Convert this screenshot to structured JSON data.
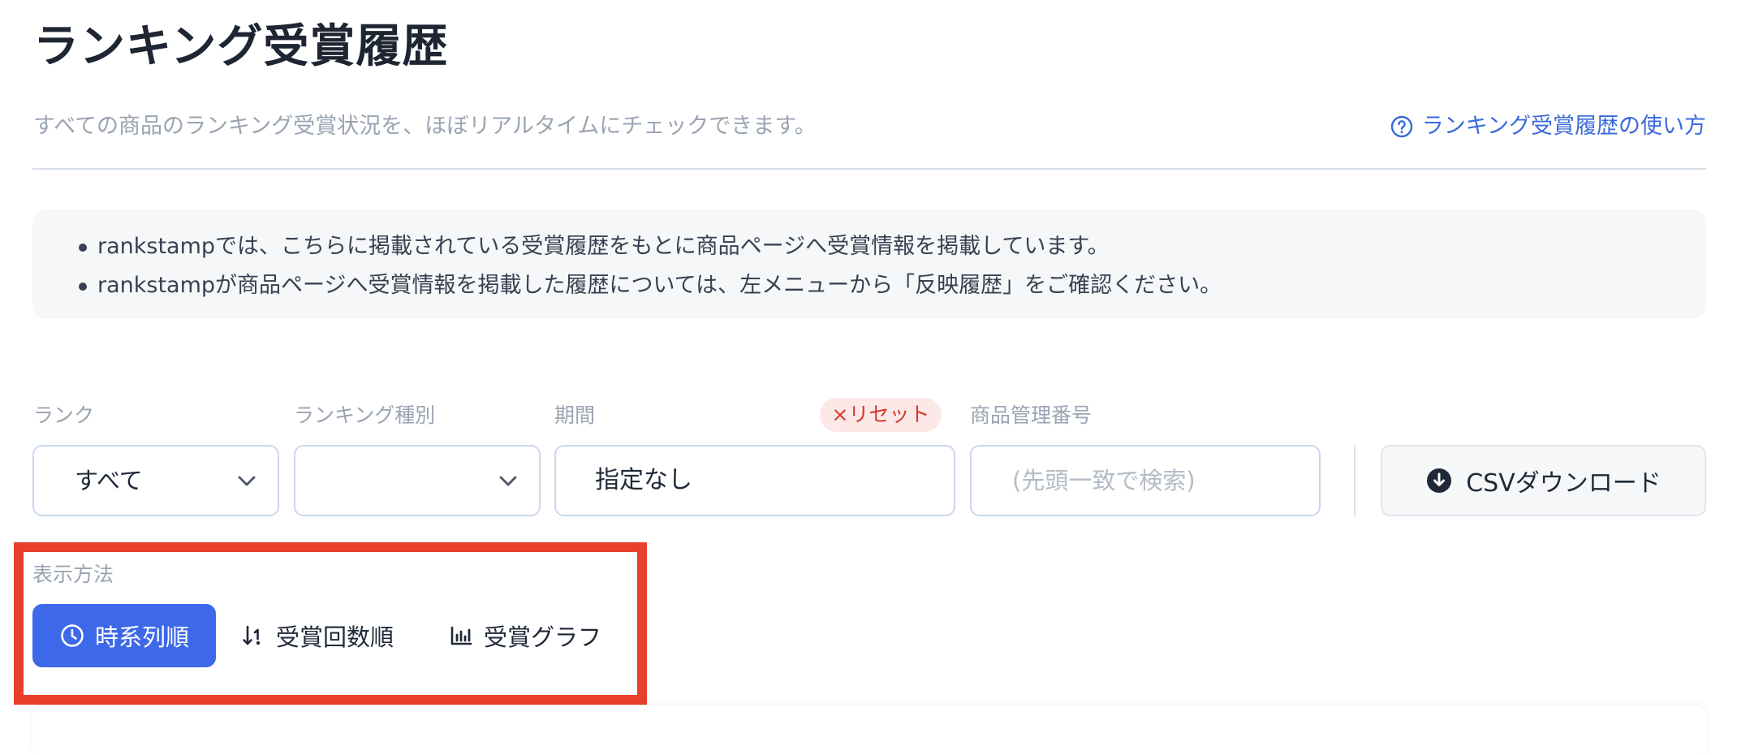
{
  "page": {
    "title": "ランキング受賞履歴",
    "subtitle": "すべての商品のランキング受賞状況を、ほぼリアルタイムにチェックできます。",
    "help_link": "ランキング受賞履歴の使い方"
  },
  "notice": {
    "items": [
      "rankstampでは、こちらに掲載されている受賞履歴をもとに商品ページへ受賞情報を掲載しています。",
      "rankstampが商品ページへ受賞情報を掲載した履歴については、左メニューから「反映履歴」をご確認ください。"
    ]
  },
  "filters": {
    "rank": {
      "label": "ランク",
      "value": "すべて"
    },
    "ranking_type": {
      "label": "ランキング種別",
      "value": ""
    },
    "period": {
      "label": "期間",
      "value": "指定なし",
      "reset_label": "×リセット"
    },
    "product_code": {
      "label": "商品管理番号",
      "placeholder": "(先頭一致で検索)"
    },
    "csv_button": "CSVダウンロード"
  },
  "view": {
    "label": "表示方法",
    "modes": [
      {
        "label": "時系列順",
        "active": true,
        "icon": "clock-icon"
      },
      {
        "label": "受賞回数順",
        "active": false,
        "icon": "sort-icon"
      },
      {
        "label": "受賞グラフ",
        "active": false,
        "icon": "bar-chart-icon"
      }
    ]
  },
  "colors": {
    "accent": "#3d68e8",
    "link": "#3a6ad9",
    "highlight_border": "#e8402a",
    "reset": "#d9372b"
  }
}
